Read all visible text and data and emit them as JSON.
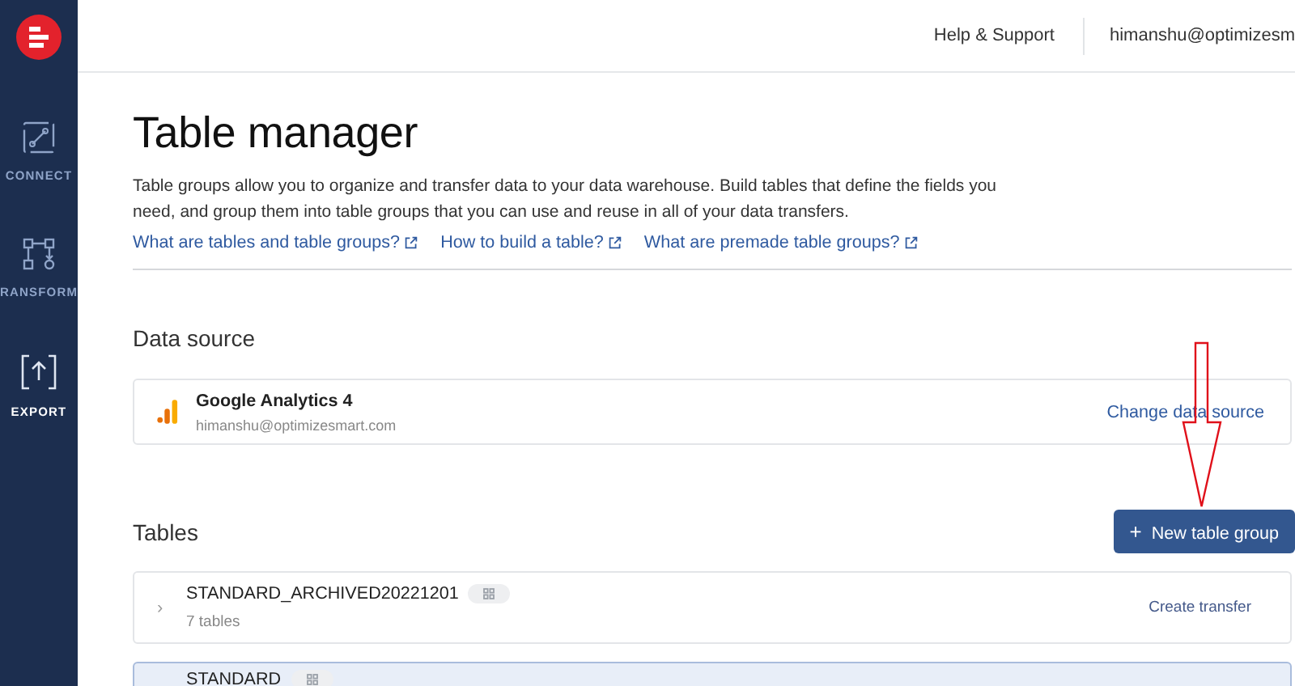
{
  "sidebar": {
    "items": [
      {
        "label": "CONNECT",
        "kind": "connect"
      },
      {
        "label": "RANSFORM",
        "kind": "transform"
      },
      {
        "label": "EXPORT",
        "kind": "export"
      }
    ]
  },
  "topbar": {
    "help": "Help & Support",
    "user": "himanshu@optimizesm"
  },
  "title": "Table manager",
  "description": "Table groups allow you to organize and transfer data to your data warehouse. Build tables that define the fields you need, and group them into table groups that you can use and reuse in all of your data transfers.",
  "links": [
    "What are tables and table groups?",
    "How to build a table?",
    "What are premade table groups?"
  ],
  "data_source": {
    "heading": "Data source",
    "name": "Google Analytics 4",
    "account": "himanshu@optimizesmart.com",
    "action": "Change data source"
  },
  "tables": {
    "heading": "Tables",
    "button": "New table group",
    "button_icon": "+",
    "rows": [
      {
        "name": "STANDARD_ARCHIVED20221201",
        "count": "7 tables",
        "action": "Create transfer",
        "caret": "›",
        "selected": false
      },
      {
        "name": "STANDARD",
        "selected": true
      }
    ]
  }
}
